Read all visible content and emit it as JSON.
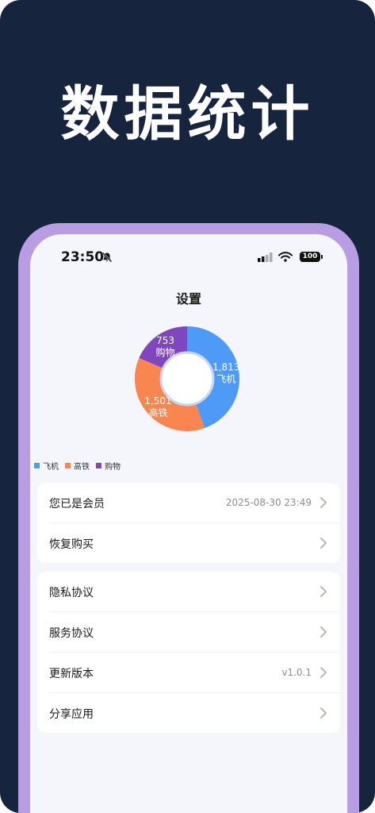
{
  "headline": "数据统计",
  "status_bar": {
    "time": "23:50",
    "battery": "100"
  },
  "page_title": "设置",
  "chart_data": {
    "type": "pie",
    "categories": [
      "飞机",
      "高铁",
      "购物"
    ],
    "values": [
      1813,
      1501,
      753
    ],
    "value_labels": [
      "1,813",
      "1,501",
      "753"
    ],
    "colors": [
      "#4e9af7",
      "#f98550",
      "#8046bd"
    ],
    "donut": true,
    "legend_position": "bottom-left"
  },
  "legend": [
    {
      "label": "飞机",
      "color": "#4e9af7"
    },
    {
      "label": "高铁",
      "color": "#f98550"
    },
    {
      "label": "购物",
      "color": "#8046bd"
    }
  ],
  "membership": {
    "member_label": "您已是会员",
    "member_date": "2025-08-30 23:49",
    "restore_label": "恢复购买"
  },
  "settings": {
    "privacy_label": "隐私协议",
    "service_label": "服务协议",
    "update_label": "更新版本",
    "version": "v1.0.1",
    "share_label": "分享应用"
  },
  "icons": [
    "bell-slash-icon",
    "signal-icon",
    "wifi-icon",
    "battery-icon",
    "chevron-right-icon"
  ]
}
